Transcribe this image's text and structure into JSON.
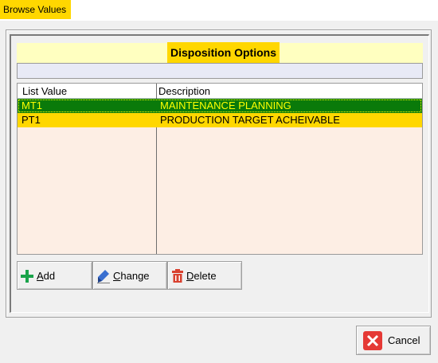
{
  "window": {
    "title": "Browse Values"
  },
  "header": {
    "title": "Disposition Options",
    "filter_value": ""
  },
  "list": {
    "columns": [
      "List Value",
      "Description"
    ],
    "rows": [
      {
        "value": "MT1",
        "description": "MAINTENANCE PLANNING",
        "selected": true
      },
      {
        "value": "PT1",
        "description": "PRODUCTION TARGET ACHEIVABLE",
        "selected": false
      }
    ]
  },
  "buttons": {
    "add": {
      "accel": "A",
      "rest": "dd",
      "icon": "plus-icon"
    },
    "change": {
      "accel": "C",
      "rest": "hange",
      "icon": "pencil-icon"
    },
    "delete": {
      "accel": "D",
      "rest": "elete",
      "icon": "trash-icon"
    },
    "cancel": {
      "label": "Cancel",
      "icon": "close-icon"
    }
  },
  "colors": {
    "highlight_yellow": "#ffd700",
    "header_band": "#ffffc0",
    "selected_row": "#0a7a0a",
    "selected_text": "#ffff00",
    "list_background": "#fdeee4",
    "cancel_red": "#e53935"
  }
}
